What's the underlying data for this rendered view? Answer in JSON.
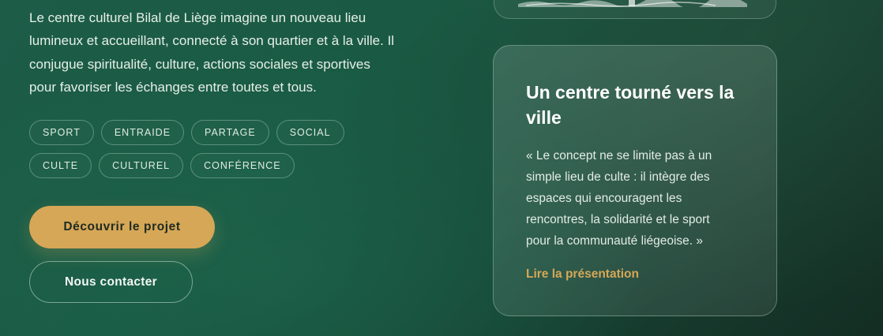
{
  "intro": {
    "text": "Le centre culturel Bilal de Liège imagine un nouveau lieu lumineux et accueillant, connecté à son quartier et à la ville. Il conjugue spiritualité, culture, actions sociales et sportives pour favoriser les échanges entre toutes et tous."
  },
  "tags": [
    "SPORT",
    "ENTRAIDE",
    "PARTAGE",
    "SOCIAL",
    "CULTE",
    "CULTUREL",
    "CONFÉRENCE"
  ],
  "actions": {
    "primary_label": "Découvrir le projet",
    "secondary_label": "Nous contacter"
  },
  "card": {
    "title": "Un centre tourné vers la ville",
    "quote": "« Le concept ne se limite pas à un simple lieu de culte : il intègre des espaces qui encouragent les rencontres, la solidarité et le sport pour la communauté liégeoise. »",
    "link_label": "Lire la présentation"
  },
  "colors": {
    "accent": "#d6a756",
    "background": "#1a5a44"
  }
}
